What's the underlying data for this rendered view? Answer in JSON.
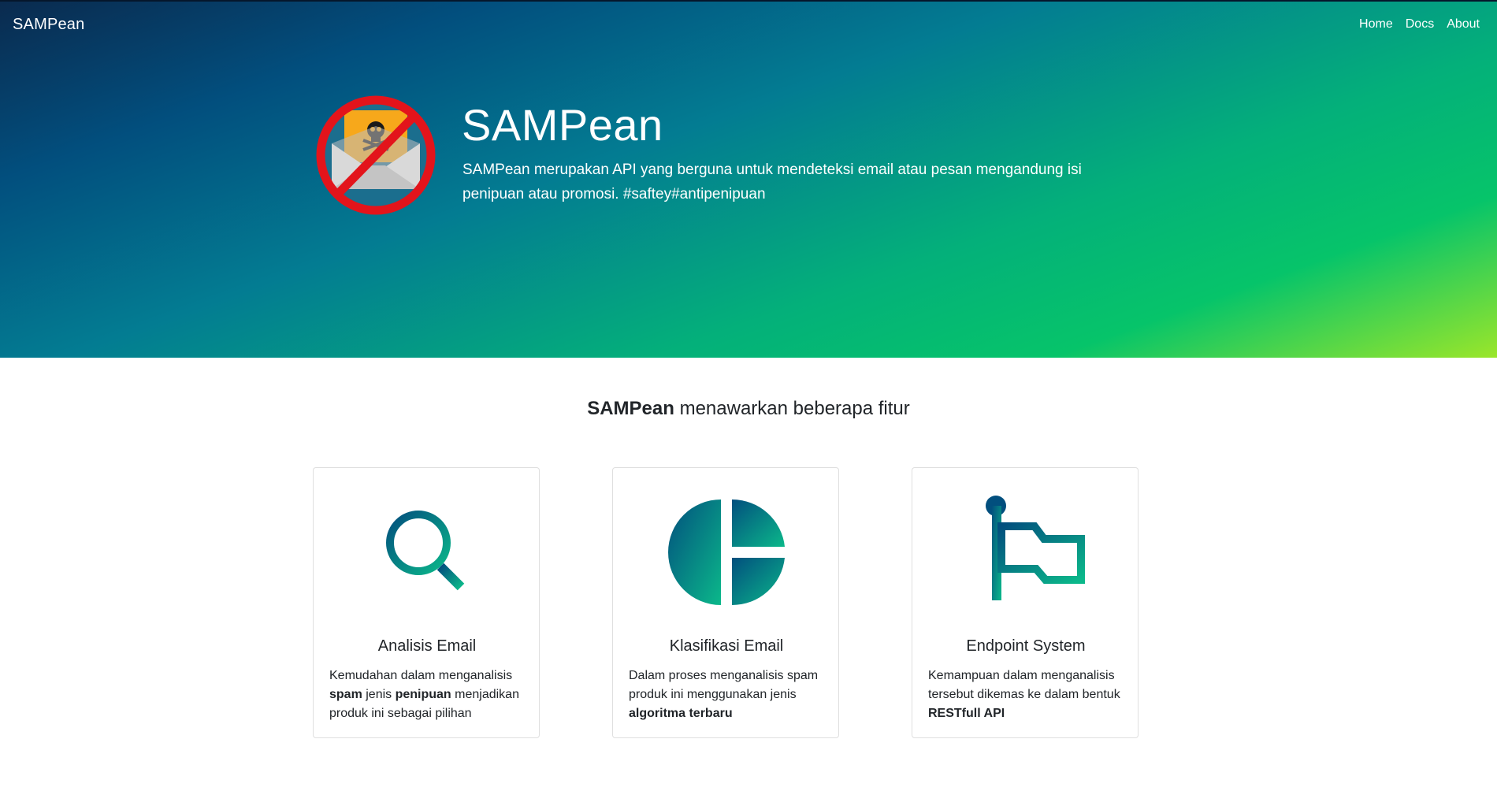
{
  "colors": {
    "gradient_dark": "#0a2a4e",
    "gradient_mid": "#037c92",
    "gradient_green": "#06c46a",
    "gradient_lime": "#9ae62a",
    "icon_dark": "#024f7e",
    "icon_light": "#0bb88a"
  },
  "navbar": {
    "brand": "SAMPean",
    "links": [
      {
        "label": "Home"
      },
      {
        "label": "Docs"
      },
      {
        "label": "About"
      }
    ]
  },
  "hero": {
    "logo_icon": "no-spam-envelope-icon",
    "title": "SAMPean",
    "description": "SAMPean merupakan API yang berguna untuk mendeteksi email atau pesan mengandung isi penipuan atau promosi. #saftey#antipenipuan"
  },
  "features": {
    "heading_bold": "SAMPean",
    "heading_rest": " menawarkan beberapa fitur",
    "cards": [
      {
        "icon": "search-icon",
        "title": "Analisis Email",
        "text": [
          {
            "t": "Kemudahan dalam menganalisis ",
            "b": false
          },
          {
            "t": "spam",
            "b": true
          },
          {
            "t": " jenis ",
            "b": false
          },
          {
            "t": "penipuan",
            "b": true
          },
          {
            "t": " menjadikan produk ini sebagai pilihan",
            "b": false
          }
        ]
      },
      {
        "icon": "pie-chart-icon",
        "title": "Klasifikasi Email",
        "text": [
          {
            "t": "Dalam proses menganalisis spam produk ini menggunakan jenis ",
            "b": false
          },
          {
            "t": "algoritma terbaru",
            "b": true
          }
        ]
      },
      {
        "icon": "flag-icon",
        "title": "Endpoint System",
        "text": [
          {
            "t": "Kemampuan dalam menganalisis tersebut dikemas ke dalam bentuk ",
            "b": false
          },
          {
            "t": "RESTfull API",
            "b": true
          }
        ]
      }
    ]
  }
}
